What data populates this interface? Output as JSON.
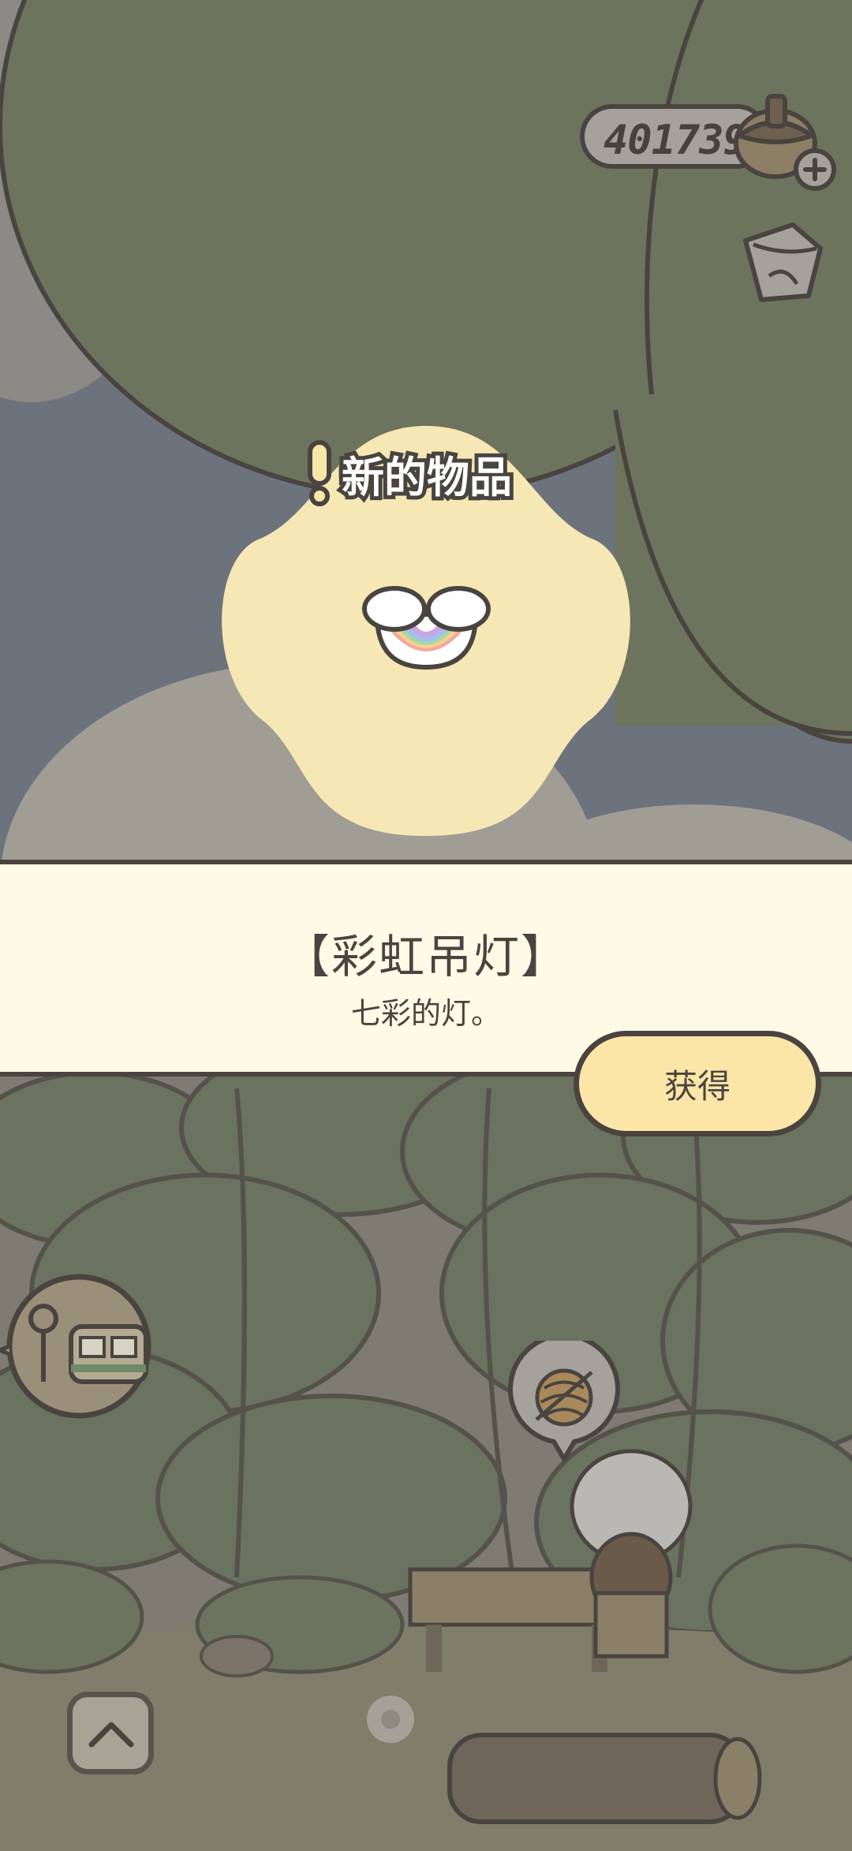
{
  "hud": {
    "coin_count": "401739",
    "coin_icon": "acorn-icon",
    "mail_icon": "mail-icon"
  },
  "popup": {
    "new_item_label": "新的物品",
    "item_icon": "rainbow-lamp-icon"
  },
  "banner": {
    "item_name": "【彩虹吊灯】",
    "item_description": "七彩的灯。",
    "get_button_label": "获得"
  },
  "scene": {
    "train_bubble_icon": "train-icon",
    "yarn_bubble_icon": "yarn-icon",
    "scroll_up_icon": "chevron-up-icon"
  },
  "colors": {
    "outline": "#4a4440",
    "banner_bg": "#fdfbe6",
    "button_bg": "#fbe6a8",
    "blob": "#f5e8b4",
    "foliage": "#6b7460"
  }
}
